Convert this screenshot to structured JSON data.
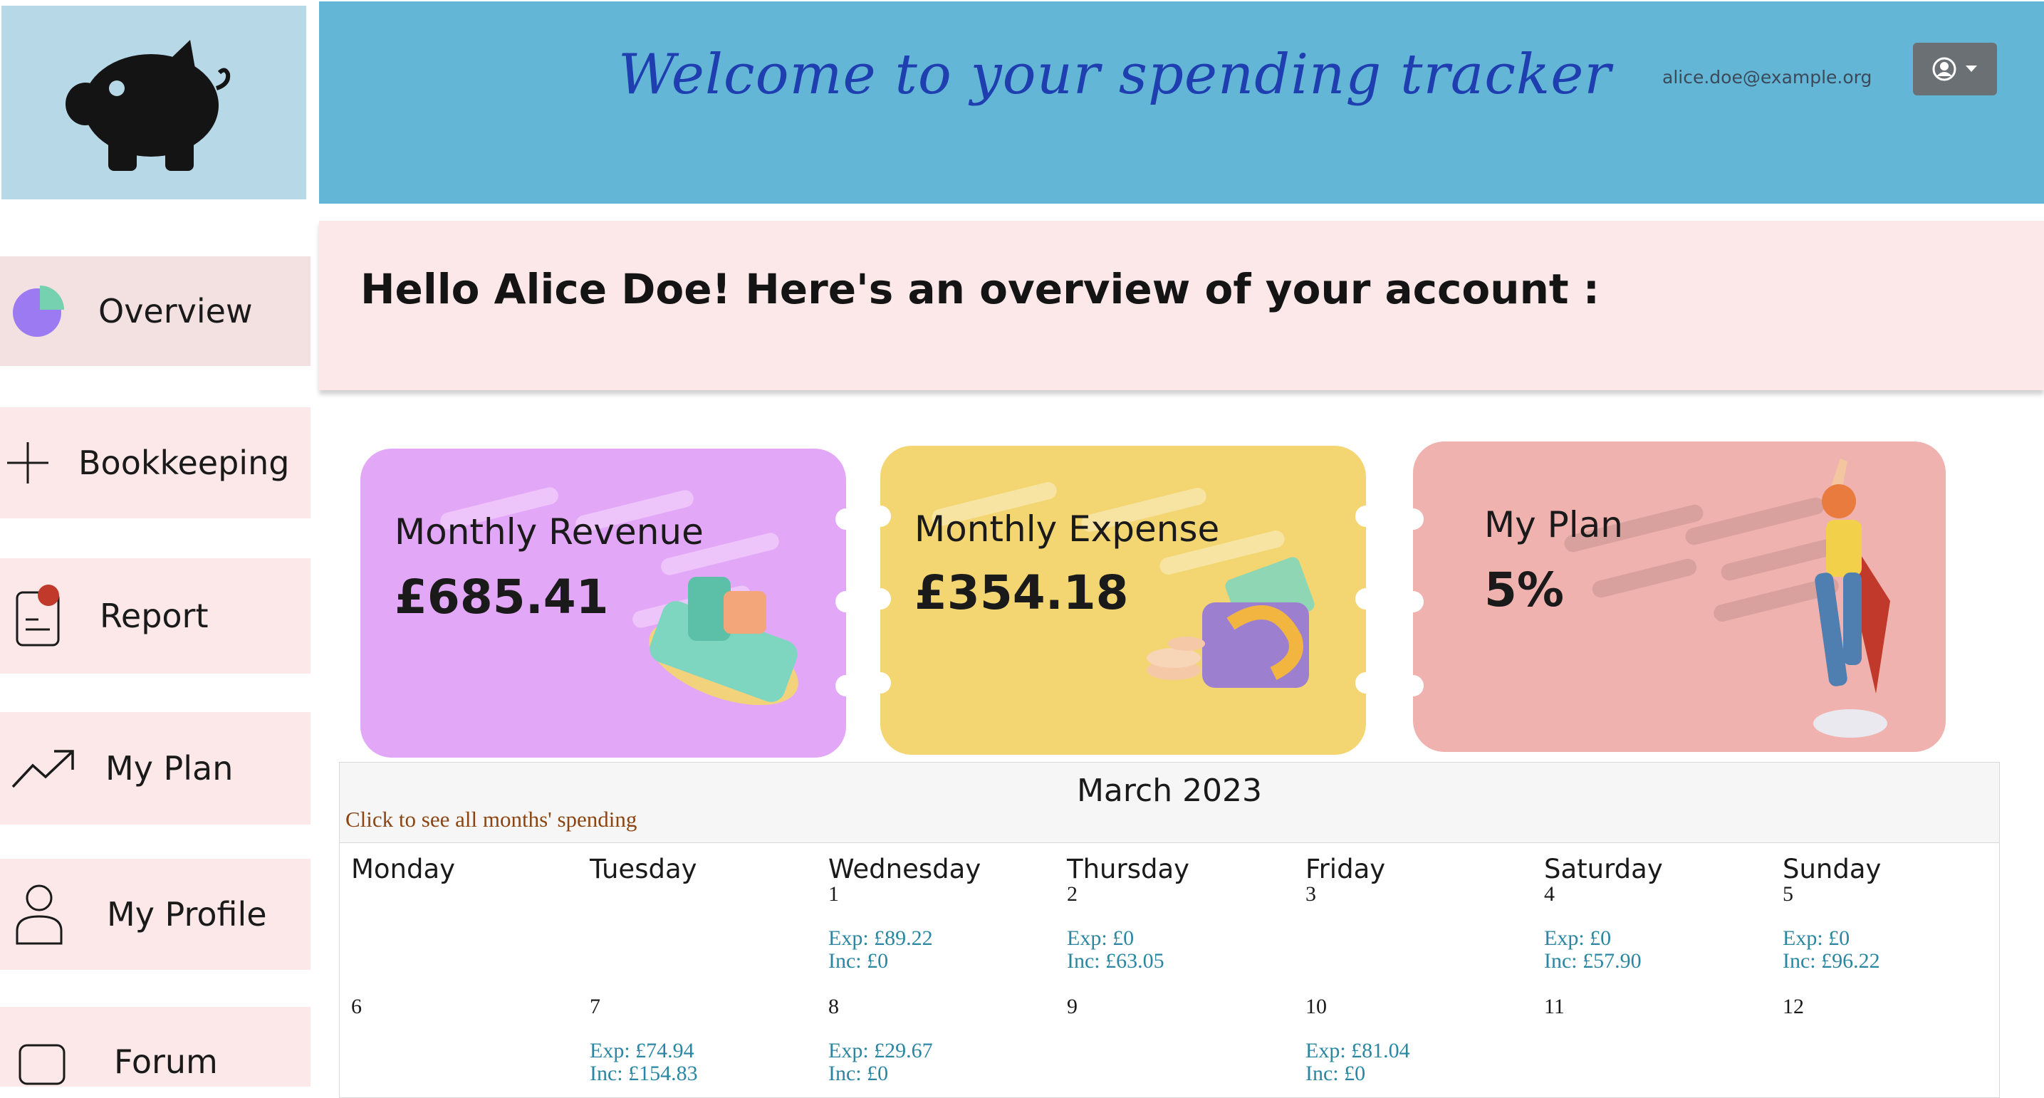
{
  "header": {
    "title": "Welcome to your spending tracker",
    "email": "alice.doe@example.org",
    "user_menu_icon": "user-circle-icon",
    "caret_icon": "caret-down-icon",
    "bg_color": "#63b6d6",
    "title_color": "#1f3fb0"
  },
  "logo": {
    "icon": "piggy-bank-icon",
    "bg_color": "#b7d8e6"
  },
  "sidebar": {
    "items": [
      {
        "label": "Overview",
        "icon": "pie-chart-icon",
        "active": true
      },
      {
        "label": "Bookkeeping",
        "icon": "plus-icon"
      },
      {
        "label": "Report",
        "icon": "report-icon"
      },
      {
        "label": "My Plan",
        "icon": "trending-up-icon"
      },
      {
        "label": "My Profile",
        "icon": "person-icon"
      },
      {
        "label": "Forum",
        "icon": "chat-icon"
      }
    ],
    "bg_color": "#fce8e8"
  },
  "greeting": {
    "text": "Hello Alice Doe! Here's an overview of your account :"
  },
  "cards": [
    {
      "title": "Monthly Revenue",
      "value": "£685.41",
      "color": "#e3a7f7"
    },
    {
      "title": "Monthly Expense",
      "value": "£354.18",
      "color": "#f3d672"
    },
    {
      "title": "My Plan",
      "value": "5%",
      "color": "#efb2ae"
    }
  ],
  "calendar": {
    "title": "March 2023",
    "link": "Click to see all months' spending",
    "weekdays": [
      "Monday",
      "Tuesday",
      "Wednesday",
      "Thursday",
      "Friday",
      "Saturday",
      "Sunday"
    ],
    "weeks": [
      [
        {
          "day": "",
          "exp": "",
          "inc": ""
        },
        {
          "day": "",
          "exp": "",
          "inc": ""
        },
        {
          "day": "1",
          "exp": "Exp: £89.22",
          "inc": "Inc: £0"
        },
        {
          "day": "2",
          "exp": "Exp: £0",
          "inc": "Inc: £63.05"
        },
        {
          "day": "3",
          "exp": "",
          "inc": ""
        },
        {
          "day": "4",
          "exp": "Exp: £0",
          "inc": "Inc: £57.90"
        },
        {
          "day": "5",
          "exp": "Exp: £0",
          "inc": "Inc: £96.22"
        }
      ],
      [
        {
          "day": "6",
          "exp": "",
          "inc": ""
        },
        {
          "day": "7",
          "exp": "Exp: £74.94",
          "inc": "Inc: £154.83"
        },
        {
          "day": "8",
          "exp": "Exp: £29.67",
          "inc": "Inc: £0"
        },
        {
          "day": "9",
          "exp": "",
          "inc": ""
        },
        {
          "day": "10",
          "exp": "Exp: £81.04",
          "inc": "Inc: £0"
        },
        {
          "day": "11",
          "exp": "",
          "inc": ""
        },
        {
          "day": "12",
          "exp": "",
          "inc": ""
        }
      ]
    ],
    "amount_color": "#2a86a3"
  }
}
